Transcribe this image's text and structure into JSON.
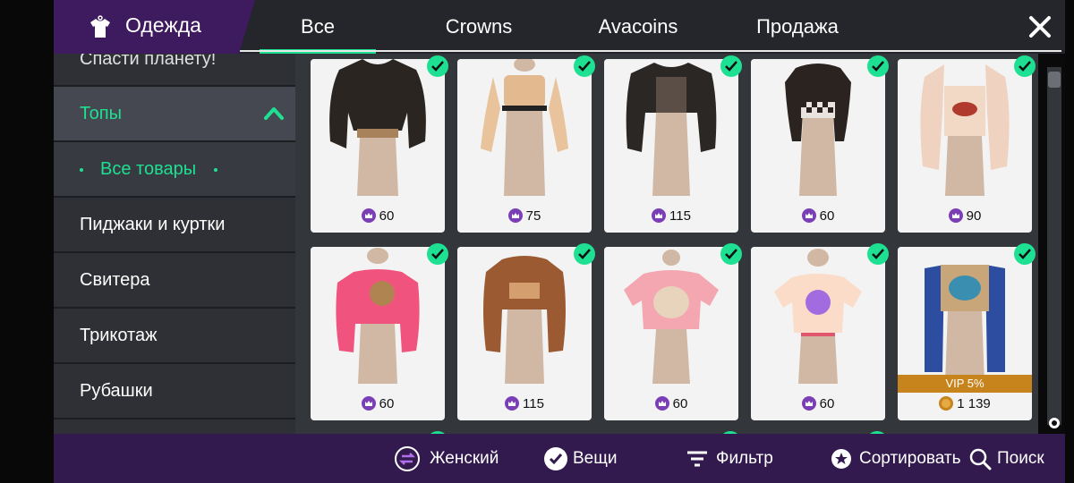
{
  "header": {
    "title": "Одежда",
    "tabs": [
      {
        "label": "Все",
        "active": true
      },
      {
        "label": "Crowns",
        "active": false
      },
      {
        "label": "Avacoins",
        "active": false
      },
      {
        "label": "Продажа",
        "active": false
      }
    ],
    "accent": "#1ee092"
  },
  "sidebar": {
    "partial_item": "Спасти планету!",
    "section": "Топы",
    "selected_sub": "Все товары",
    "items": [
      "Пиджаки и куртки",
      "Свитера",
      "Трикотаж",
      "Рубашки"
    ]
  },
  "items": [
    {
      "price": "60",
      "currency": "crowns",
      "owned": true
    },
    {
      "price": "75",
      "currency": "crowns",
      "owned": true
    },
    {
      "price": "115",
      "currency": "crowns",
      "owned": true
    },
    {
      "price": "60",
      "currency": "crowns",
      "owned": true
    },
    {
      "price": "90",
      "currency": "crowns",
      "owned": true
    },
    {
      "price": "60",
      "currency": "crowns",
      "owned": true
    },
    {
      "price": "115",
      "currency": "crowns",
      "owned": true
    },
    {
      "price": "60",
      "currency": "crowns",
      "owned": true
    },
    {
      "price": "60",
      "currency": "crowns",
      "owned": true
    },
    {
      "price": "1 139",
      "currency": "avacoins",
      "owned": true,
      "badge": "VIP 5%"
    }
  ],
  "bottom": {
    "gender": "Женский",
    "items": "Вещи",
    "filter": "Фильтр",
    "sort": "Сортировать",
    "search": "Поиск"
  }
}
